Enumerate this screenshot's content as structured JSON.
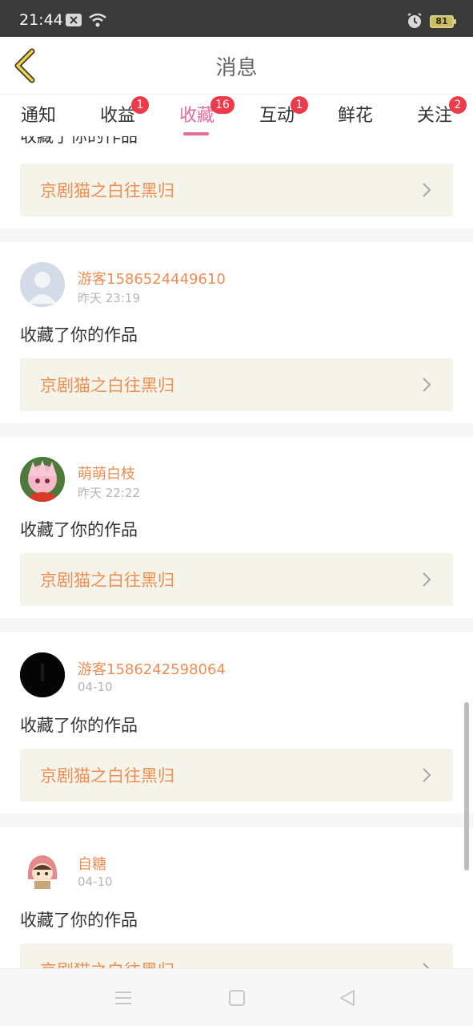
{
  "status_bar": {
    "time": "21:44",
    "battery": "81",
    "icons": [
      "notification-icon",
      "wifi-icon",
      "alarm-icon",
      "battery-icon"
    ]
  },
  "header": {
    "title": "消息"
  },
  "tabs": [
    {
      "label": "通知",
      "badge": null
    },
    {
      "label": "收益",
      "badge": "1"
    },
    {
      "label": "收藏",
      "badge": "16",
      "active": true
    },
    {
      "label": "互动",
      "badge": "1"
    },
    {
      "label": "鲜花",
      "badge": null
    },
    {
      "label": "关注",
      "badge": "2"
    }
  ],
  "partial_top": {
    "action": "收藏了你的作品",
    "work_title": "京剧猫之白往黑归"
  },
  "items": [
    {
      "username": "游客1586524449610",
      "time": "昨天 23:19",
      "action": "收藏了你的作品",
      "work_title": "京剧猫之白往黑归",
      "avatar": "default-avatar"
    },
    {
      "username": "萌萌白枝",
      "time": "昨天 22:22",
      "action": "收藏了你的作品",
      "work_title": "京剧猫之白往黑归",
      "avatar": "anime-avatar-pink"
    },
    {
      "username": "游客1586242598064",
      "time": "04-10",
      "action": "收藏了你的作品",
      "work_title": "京剧猫之白往黑归",
      "avatar": "dark-avatar"
    },
    {
      "username": "自糖",
      "time": "04-10",
      "action": "收藏了你的作品",
      "work_title": "京剧猫之白往黑归",
      "avatar": "cartoon-avatar"
    }
  ],
  "colors": {
    "accent": "#e56aa0",
    "badge": "#ef3a4a",
    "username": "#ef8e52",
    "work_bg": "#f5f4ea"
  },
  "nav_buttons": [
    "menu-icon",
    "home-icon",
    "back-triangle-icon"
  ]
}
